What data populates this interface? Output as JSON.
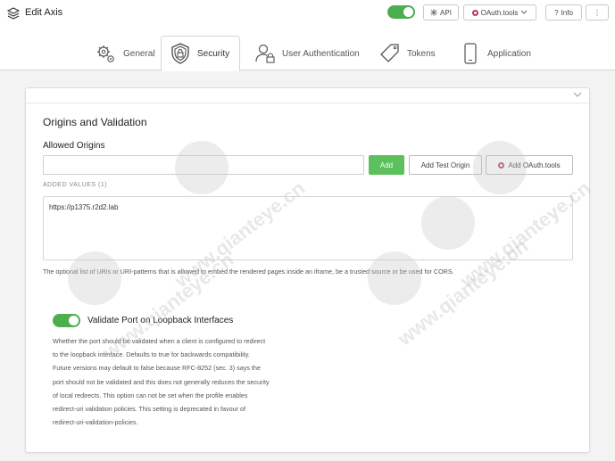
{
  "header": {
    "title": "Edit Axis",
    "app_icon": "cube-icon",
    "toggle_enabled": true,
    "buttons": {
      "api": "API",
      "oauth_tools": "OAuth.tools",
      "info": "Info",
      "more": "⋮"
    }
  },
  "tabs": [
    {
      "label": "General",
      "icon": "gears-icon",
      "active": false
    },
    {
      "label": "Security",
      "icon": "shield-lock-icon",
      "active": true
    },
    {
      "label": "User Authentication",
      "icon": "user-lock-icon",
      "active": false
    },
    {
      "label": "Tokens",
      "icon": "tag-icon",
      "active": false
    },
    {
      "label": "Application",
      "icon": "mobile-icon",
      "active": false
    }
  ],
  "section": {
    "title": "Origins and Validation",
    "allowed_origins": {
      "label": "Allowed Origins",
      "input_value": "",
      "add_button": "Add",
      "test_button": "Add Test Origin",
      "oauth_button": "Add OAuth.tools",
      "added_values_label": "ADDED VALUES (1)",
      "values": [
        "https://p1375.r2d2.lab"
      ],
      "help_text": "The optional list of URIs or URI-patterns that is allowed to embed the rendered pages inside an iframe, be a trusted source or be used for CORS."
    },
    "validate_port": {
      "enabled": true,
      "label": "Validate Port on Loopback Interfaces",
      "description_lines": [
        "Whether the port should be validated when a client is configured to redirect",
        "to the loopback interface. Defaults to true for backwards compatibility.",
        "Future versions may default to false because RFC-8252 (sec. 3) says the",
        "port should not be validated and this does not generally reduces the security",
        "of local redirects. This option can not be set when the profile enables",
        "redirect-uri validation policies. This setting is deprecated in favour of",
        "redirect-uri-validation-policies."
      ]
    }
  },
  "watermark": {
    "text": "www.qianteye.cn",
    "badge": "QIANTEYE"
  },
  "colors": {
    "accent_green": "#5cc05c",
    "toggle_green": "#4cae4c",
    "oauth_brand": "#b23a6b"
  }
}
